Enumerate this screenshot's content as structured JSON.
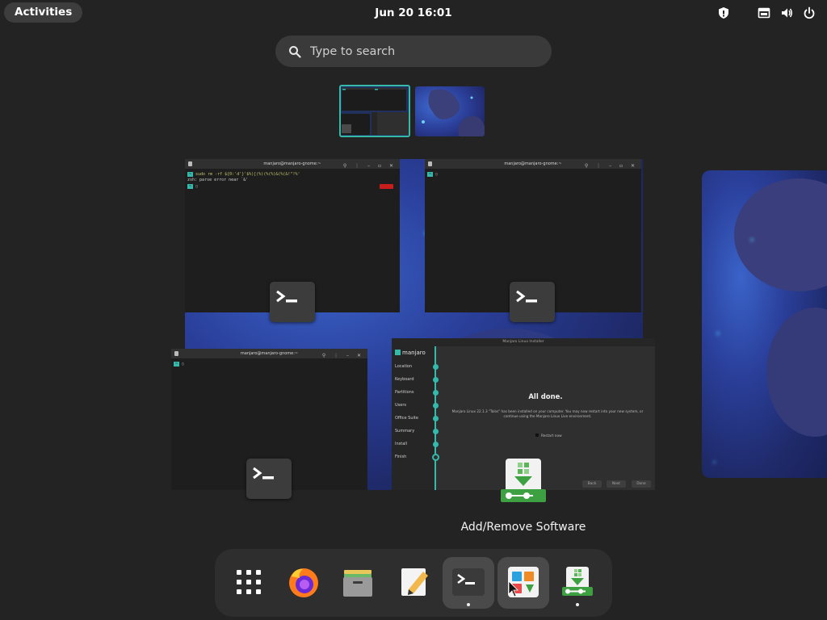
{
  "topbar": {
    "activities_label": "Activities",
    "clock": "Jun 20  16:01",
    "tray_icons": [
      "shield-icon",
      "network-icon",
      "volume-icon",
      "power-icon"
    ]
  },
  "search": {
    "placeholder": "Type to search"
  },
  "workspaces": [
    "workspace-1",
    "workspace-2"
  ],
  "windows": {
    "terminal1": {
      "title": "manjaro@manjaro-gnome:~",
      "line1": "sudo rm -rf ${0:'d'}'$%)[(%)(%(%)&(%(&!\"!%'",
      "line2": "zsh: parse error near `&'"
    },
    "terminal2": {
      "title": "manjaro@manjaro-gnome:~"
    },
    "terminal3": {
      "title": "manjaro@manjaro-gnome:~"
    },
    "installer": {
      "title": "Manjaro Linux Installer",
      "brand": "manjaro",
      "steps": [
        "Location",
        "Keyboard",
        "Partitions",
        "Users",
        "Office Suite",
        "Summary",
        "Install",
        "Finish"
      ],
      "heading": "All done.",
      "description": "Manjaro Linux 22.1.3 \"Talos\" has been installed on your computer. You may now restart into your new system, or continue using the Manjaro Linux Live environment.",
      "restart_label": "Restart now",
      "buttons": [
        "Back",
        "Next",
        "Done"
      ]
    }
  },
  "hover_label": "Add/Remove Software",
  "dock": {
    "items": [
      {
        "name": "show-apps",
        "icon": "grid-icon"
      },
      {
        "name": "firefox",
        "icon": "firefox-icon"
      },
      {
        "name": "files",
        "icon": "files-icon"
      },
      {
        "name": "text-editor",
        "icon": "text-editor-icon"
      },
      {
        "name": "terminal",
        "icon": "terminal-icon",
        "running": true
      },
      {
        "name": "software-center",
        "icon": "software-icon"
      },
      {
        "name": "add-remove-software",
        "icon": "pamac-icon",
        "running": true
      }
    ]
  },
  "colors": {
    "accent": "#35b9ab",
    "panel": "#232323",
    "dock": "#2e2e2e"
  }
}
